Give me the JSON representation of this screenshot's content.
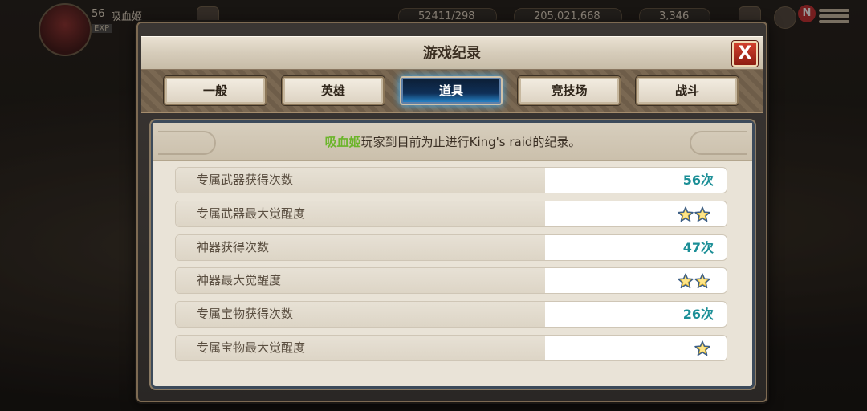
{
  "hud": {
    "level": "56",
    "player_name": "吸血姬",
    "exp_label": "EXP",
    "stamina": "52411/298",
    "gold": "205,021,668",
    "rubies": "3,346",
    "notification_badge": "N"
  },
  "dialog": {
    "title": "游戏纪录",
    "close_label": "X",
    "tabs": [
      {
        "label": "一般",
        "active": false
      },
      {
        "label": "英雄",
        "active": false
      },
      {
        "label": "道具",
        "active": true
      },
      {
        "label": "竞技场",
        "active": false
      },
      {
        "label": "战斗",
        "active": false
      }
    ]
  },
  "banner": {
    "player_name": "吸血姬",
    "text": "玩家到目前为止进行King's raid的纪录。"
  },
  "records": [
    {
      "label": "专属武器获得次数",
      "value": "56次",
      "stars": 0
    },
    {
      "label": "专属武器最大觉醒度",
      "value": "",
      "stars": 2
    },
    {
      "label": "神器获得次数",
      "value": "47次",
      "stars": 0
    },
    {
      "label": "神器最大觉醒度",
      "value": "",
      "stars": 2
    },
    {
      "label": "专属宝物获得次数",
      "value": "26次",
      "stars": 0
    },
    {
      "label": "专属宝物最大觉醒度",
      "value": "",
      "stars": 1
    }
  ],
  "colors": {
    "highlight_name": "#6bb52a",
    "value_text": "#1c8f97",
    "star": "#f2c230",
    "active_tab": "#0f3058"
  }
}
